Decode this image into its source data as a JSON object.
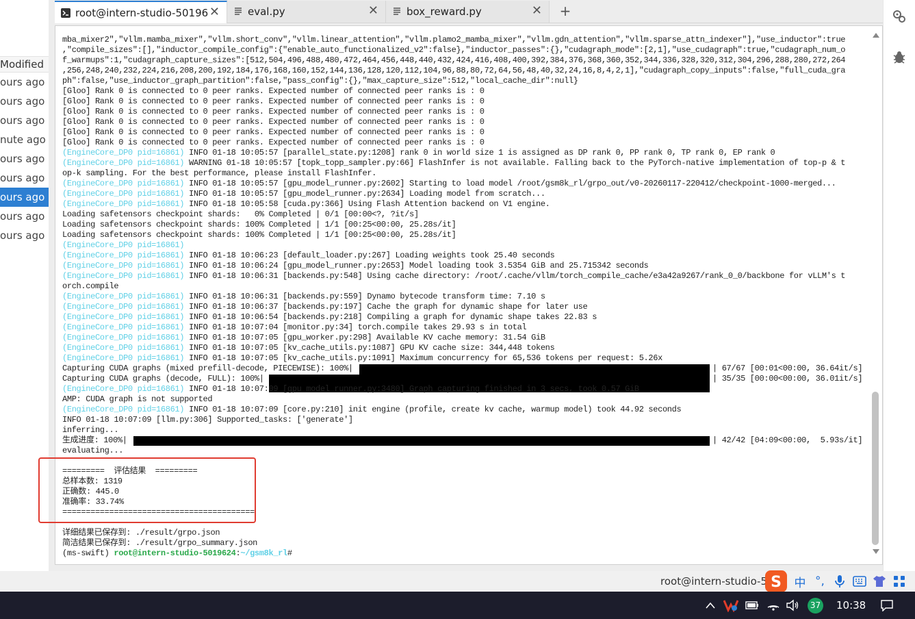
{
  "file_list": {
    "header": "Modified",
    "rows": [
      "ours ago",
      "ours ago",
      "ours ago",
      "nute ago",
      "ours ago",
      "ours ago",
      "ours ago",
      "ours ago",
      "ours ago"
    ],
    "selected_index": 6
  },
  "tabs": [
    {
      "label": "root@intern-studio-50196",
      "icon": "terminal-icon",
      "active": true
    },
    {
      "label": "eval.py",
      "icon": "file-text-icon",
      "active": false
    },
    {
      "label": "box_reward.py",
      "icon": "file-text-icon",
      "active": false
    }
  ],
  "add_tab_label": "+",
  "terminal": {
    "lines": [
      {
        "t": "mba_mixer2\",\"vllm.mamba_mixer\",\"vllm.short_conv\",\"vllm.linear_attention\",\"vllm.plamo2_mamba_mixer\",\"vllm.gdn_attention\",\"vllm.sparse_attn_indexer\"],\"use_inductor\":true"
      },
      {
        "t": ",\"compile_sizes\":[],\"inductor_compile_config\":{\"enable_auto_functionalized_v2\":false},\"inductor_passes\":{},\"cudagraph_mode\":[2,1],\"use_cudagraph\":true,\"cudagraph_num_o"
      },
      {
        "t": "f_warmups\":1,\"cudagraph_capture_sizes\":[512,504,496,488,480,472,464,456,448,440,432,424,416,408,400,392,384,376,368,360,352,344,336,328,320,312,304,296,288,280,272,264"
      },
      {
        "t": ",256,248,240,232,224,216,208,200,192,184,176,168,160,152,144,136,128,120,112,104,96,88,80,72,64,56,48,40,32,24,16,8,4,2,1],\"cudagraph_copy_inputs\":false,\"full_cuda_gra"
      },
      {
        "t": "ph\":false,\"use_inductor_graph_partition\":false,\"pass_config\":{},\"max_capture_size\":512,\"local_cache_dir\":null}"
      },
      {
        "t": "[Gloo] Rank 0 is connected to 0 peer ranks. Expected number of connected peer ranks is : 0"
      },
      {
        "t": "[Gloo] Rank 0 is connected to 0 peer ranks. Expected number of connected peer ranks is : 0"
      },
      {
        "t": "[Gloo] Rank 0 is connected to 0 peer ranks. Expected number of connected peer ranks is : 0"
      },
      {
        "t": "[Gloo] Rank 0 is connected to 0 peer ranks. Expected number of connected peer ranks is : 0"
      },
      {
        "t": "[Gloo] Rank 0 is connected to 0 peer ranks. Expected number of connected peer ranks is : 0"
      },
      {
        "t": "[Gloo] Rank 0 is connected to 0 peer ranks. Expected number of connected peer ranks is : 0"
      },
      {
        "p": "(EngineCore_DP0 pid=16861)",
        "t": " INFO 01-18 10:05:57 [parallel_state.py:1208] rank 0 in world size 1 is assigned as DP rank 0, PP rank 0, TP rank 0, EP rank 0"
      },
      {
        "p": "(EngineCore_DP0 pid=16861)",
        "t": " WARNING 01-18 10:05:57 [topk_topp_sampler.py:66] FlashInfer is not available. Falling back to the PyTorch-native implementation of top-p & t"
      },
      {
        "t": "op-k sampling. For the best performance, please install FlashInfer."
      },
      {
        "p": "(EngineCore_DP0 pid=16861)",
        "t": " INFO 01-18 10:05:57 [gpu_model_runner.py:2602] Starting to load model /root/gsm8k_rl/grpo_out/v0-20260117-220412/checkpoint-1000-merged..."
      },
      {
        "p": "(EngineCore_DP0 pid=16861)",
        "t": " INFO 01-18 10:05:57 [gpu_model_runner.py:2634] Loading model from scratch..."
      },
      {
        "p": "(EngineCore_DP0 pid=16861)",
        "t": " INFO 01-18 10:05:58 [cuda.py:366] Using Flash Attention backend on V1 engine."
      },
      {
        "t": "Loading safetensors checkpoint shards:   0% Completed | 0/1 [00:00<?, ?it/s]"
      },
      {
        "t": "Loading safetensors checkpoint shards: 100% Completed | 1/1 [00:25<00:00, 25.28s/it]"
      },
      {
        "t": "Loading safetensors checkpoint shards: 100% Completed | 1/1 [00:25<00:00, 25.28s/it]"
      },
      {
        "p": "(EngineCore_DP0 pid=16861)",
        "t": ""
      },
      {
        "p": "(EngineCore_DP0 pid=16861)",
        "t": " INFO 01-18 10:06:23 [default_loader.py:267] Loading weights took 25.40 seconds"
      },
      {
        "p": "(EngineCore_DP0 pid=16861)",
        "t": " INFO 01-18 10:06:24 [gpu_model_runner.py:2653] Model loading took 3.5354 GiB and 25.715342 seconds"
      },
      {
        "p": "(EngineCore_DP0 pid=16861)",
        "t": " INFO 01-18 10:06:31 [backends.py:548] Using cache directory: /root/.cache/vllm/torch_compile_cache/e3a42a9267/rank_0_0/backbone for vLLM's t"
      },
      {
        "t": "orch.compile"
      },
      {
        "p": "(EngineCore_DP0 pid=16861)",
        "t": " INFO 01-18 10:06:31 [backends.py:559] Dynamo bytecode transform time: 7.10 s"
      },
      {
        "p": "(EngineCore_DP0 pid=16861)",
        "t": " INFO 01-18 10:06:37 [backends.py:197] Cache the graph for dynamic shape for later use"
      },
      {
        "p": "(EngineCore_DP0 pid=16861)",
        "t": " INFO 01-18 10:06:54 [backends.py:218] Compiling a graph for dynamic shape takes 22.83 s"
      },
      {
        "p": "(EngineCore_DP0 pid=16861)",
        "t": " INFO 01-18 10:07:04 [monitor.py:34] torch.compile takes 29.93 s in total"
      },
      {
        "p": "(EngineCore_DP0 pid=16861)",
        "t": " INFO 01-18 10:07:05 [gpu_worker.py:298] Available KV cache memory: 31.54 GiB"
      },
      {
        "p": "(EngineCore_DP0 pid=16861)",
        "t": " INFO 01-18 10:07:05 [kv_cache_utils.py:1087] GPU KV cache size: 344,448 tokens"
      },
      {
        "p": "(EngineCore_DP0 pid=16861)",
        "t": " INFO 01-18 10:07:05 [kv_cache_utils.py:1091] Maximum concurrency for 65,536 tokens per request: 5.26x"
      },
      {
        "t": "Capturing CUDA graphs (mixed prefill-decode, PIECEWISE): 100%|",
        "r": "| 67/67 [00:01<00:00, 36.64it/s]"
      },
      {
        "t": "Capturing CUDA graphs (decode, FULL): 100%|",
        "r": "| 35/35 [00:00<00:00, 36.01it/s]"
      },
      {
        "p": "(EngineCore_DP0 pid=16861)",
        "t": " INFO 01-18 10:07:09 [gpu_model_runner.py:3480] Graph capturing finished in 3 secs, took 0.57 GiB"
      },
      {
        "t": "AMP: CUDA graph is not supported"
      },
      {
        "p": "(EngineCore_DP0 pid=16861)",
        "t": " INFO 01-18 10:07:09 [core.py:210] init engine (profile, create kv cache, warmup model) took 44.92 seconds"
      },
      {
        "t": "INFO 01-18 10:07:09 [llm.py:306] Supported_tasks: ['generate']"
      },
      {
        "t": "inferring..."
      },
      {
        "t": "生成进度: 100%|",
        "r": "| 42/42 [04:09<00:00,  5.93s/it]"
      },
      {
        "t": "evaluating..."
      },
      {
        "t": ""
      },
      {
        "t": "=========  评估结果  ========="
      },
      {
        "t": "总样本数: 1319"
      },
      {
        "t": "正确数: 445.0"
      },
      {
        "t": "准确率: 33.74%"
      },
      {
        "t": "========================================="
      },
      {
        "t": ""
      },
      {
        "t": "详细结果已保存到: ./result/grpo.json"
      },
      {
        "t": "简洁结果已保存到: ./result/grpo_summary.json"
      },
      {
        "t": "(ms-swift) ",
        "u": "root@intern-studio-5019624",
        "c": ":",
        "d": "~/gsm8k_rl",
        "e": "#"
      }
    ]
  },
  "status_bar": {
    "text": "root@intern-studio-50"
  },
  "ime": [
    "中",
    "°,",
    "mic",
    "keyboard",
    "shirt",
    "grid"
  ],
  "taskbar": {
    "clock": "10:38",
    "badge": "37"
  },
  "colors": {
    "accent": "#2d7fd2",
    "prefix": "#5fd0e6",
    "highlight": "#e03c31",
    "prompt_user": "#2aa84a"
  }
}
